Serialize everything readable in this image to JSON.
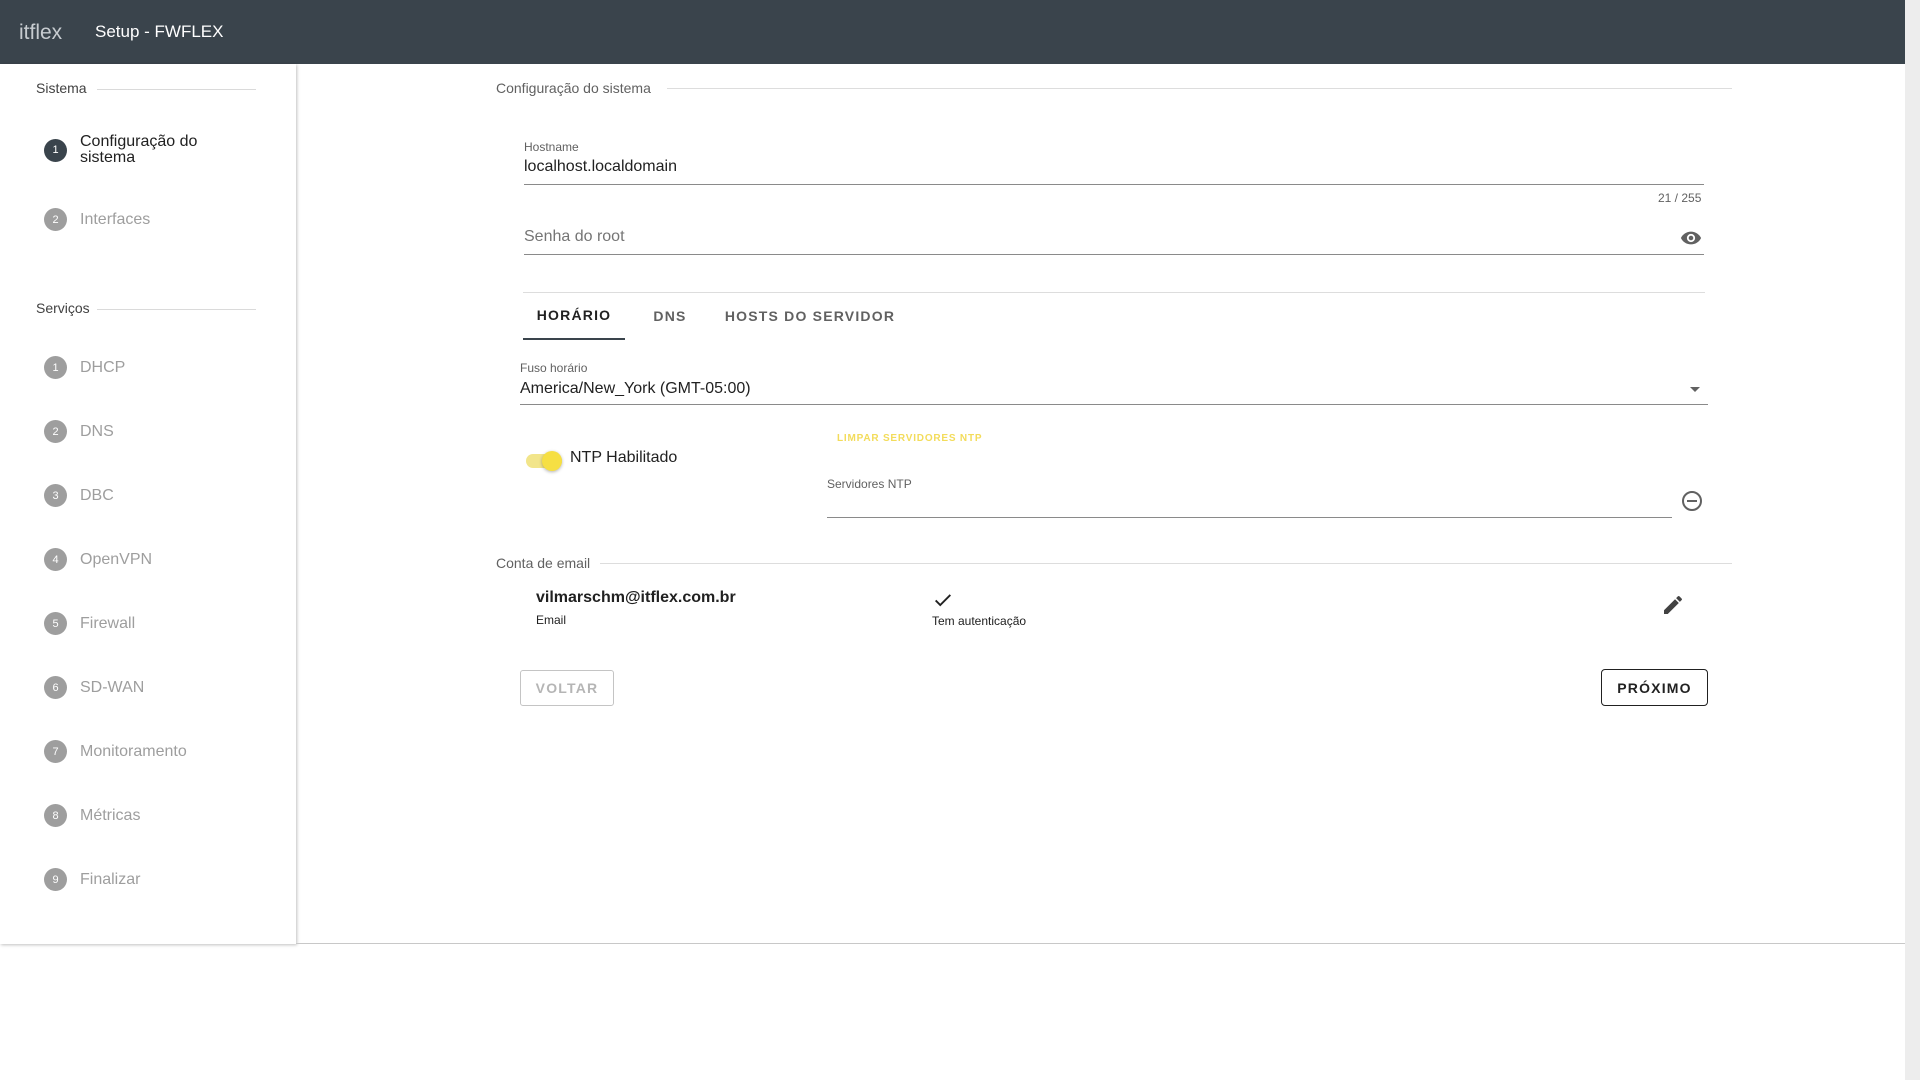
{
  "header": {
    "logo_text": "itflex",
    "title": "Setup - FWFLEX"
  },
  "sidebar": {
    "sistema_title": "Sistema",
    "sistema_steps": [
      {
        "num": "1",
        "label": "Configuração do sistema",
        "active": true
      },
      {
        "num": "2",
        "label": "Interfaces",
        "active": false
      }
    ],
    "servicos_title": "Serviços",
    "servicos_steps": [
      {
        "num": "1",
        "label": "DHCP"
      },
      {
        "num": "2",
        "label": "DNS"
      },
      {
        "num": "3",
        "label": "DBC"
      },
      {
        "num": "4",
        "label": "OpenVPN"
      },
      {
        "num": "5",
        "label": "Firewall"
      },
      {
        "num": "6",
        "label": "SD-WAN"
      },
      {
        "num": "7",
        "label": "Monitoramento"
      },
      {
        "num": "8",
        "label": "Métricas"
      },
      {
        "num": "9",
        "label": "Finalizar"
      }
    ]
  },
  "main": {
    "section_title": "Configuração do sistema",
    "hostname": {
      "label": "Hostname",
      "value": "localhost.localdomain",
      "counter": "21 / 255"
    },
    "root_password": {
      "placeholder": "Senha do root",
      "icon": "eye-icon"
    },
    "tabs": [
      {
        "label": "HORÁRIO",
        "active": true
      },
      {
        "label": "DNS",
        "active": false
      },
      {
        "label": "HOSTS DO SERVIDOR",
        "active": false
      }
    ],
    "timezone": {
      "label": "Fuso horário",
      "value": "America/New_York (GMT-05:00)"
    },
    "ntp": {
      "toggle_label": "NTP Habilitado",
      "enabled": true,
      "clear_label": "LIMPAR SERVIDORES NTP",
      "servers_label": "Servidores NTP",
      "servers_value": ""
    },
    "email_section_title": "Conta de email",
    "email": {
      "address": "vilmarschm@itflex.com.br",
      "sub": "Email",
      "auth_label": "Tem autenticação"
    },
    "buttons": {
      "back": "VOLTAR",
      "next": "PRÓXIMO"
    }
  },
  "colors": {
    "topbar": "#3a444c",
    "accent_yellow": "#f6df43",
    "muted": "#9e9e9e"
  }
}
